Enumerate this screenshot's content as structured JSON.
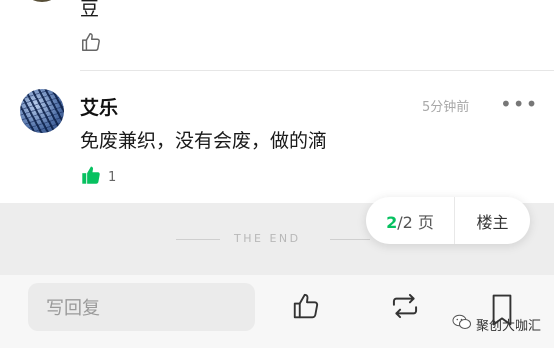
{
  "top_comment": {
    "text_tail": "豆"
  },
  "comment": {
    "author": "艾乐",
    "time": "5分钟前",
    "text": "免废兼织，没有会废，做的滴",
    "like_count": "1",
    "more_symbol": "•••"
  },
  "end_text": "THE END",
  "pager": {
    "current": "2",
    "total_suffix": "/2 页",
    "host_label": "楼主"
  },
  "bottom_bar": {
    "reply_placeholder": "写回复"
  },
  "watermark": {
    "text": "聚创大咖汇"
  },
  "colors": {
    "accent_green": "#07c160",
    "end_band": "#ededed",
    "bottom_bar": "#f7f7f7"
  },
  "icons": [
    "like-outline-icon",
    "like-filled-icon",
    "more-icon",
    "repost-icon",
    "bookmark-icon",
    "wechat-icon"
  ]
}
